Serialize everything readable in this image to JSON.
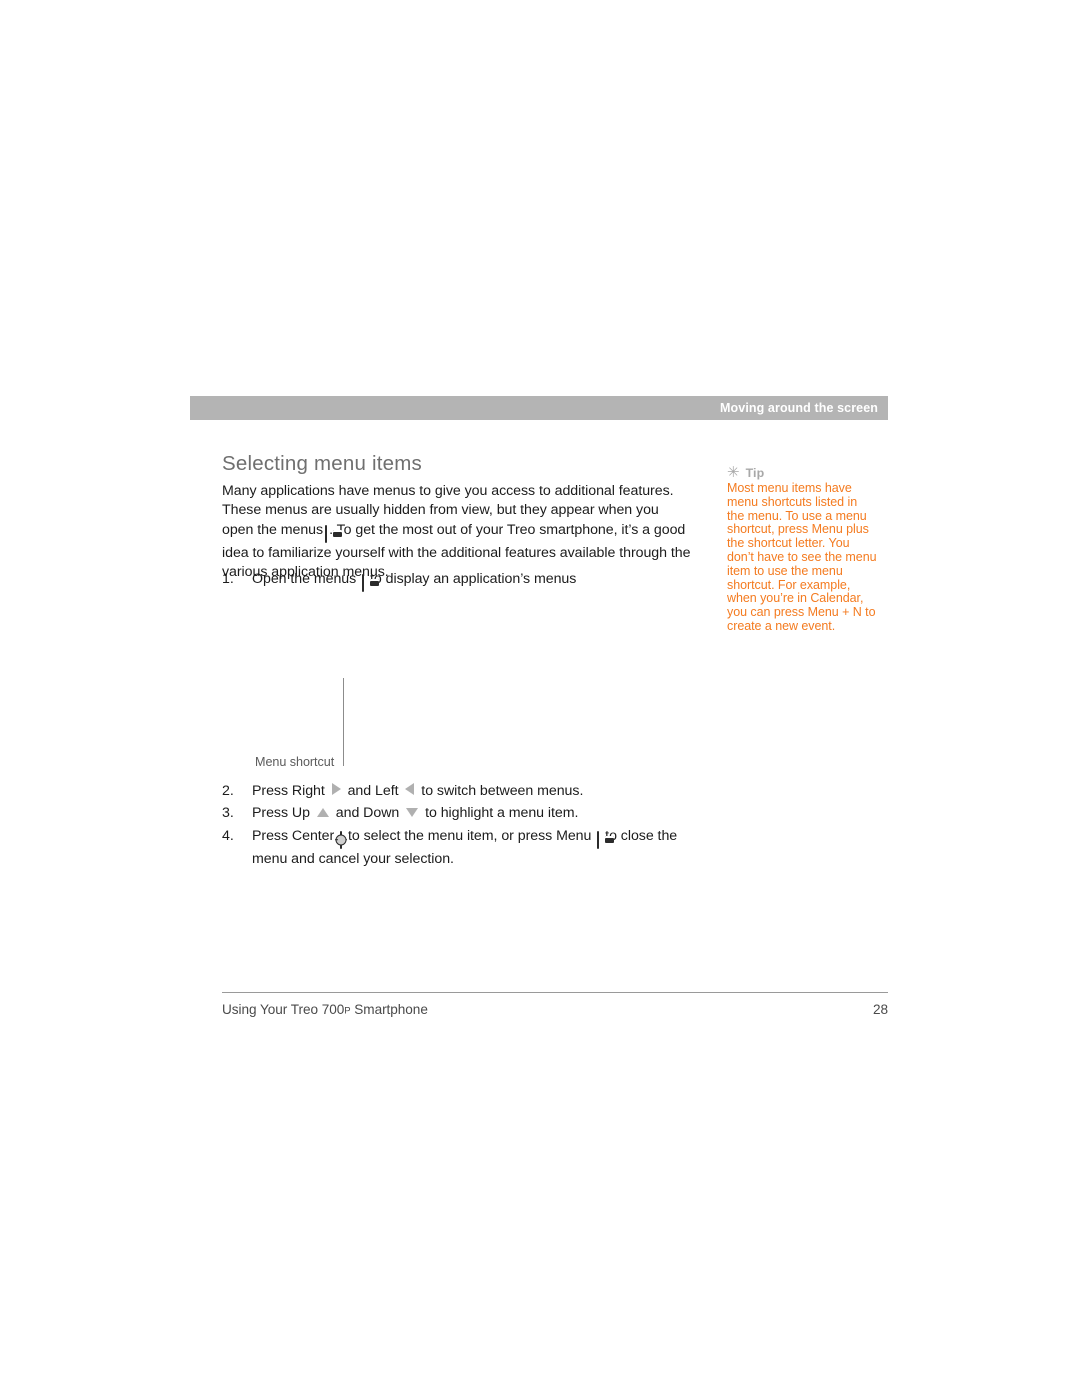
{
  "header": {
    "running_title": "Moving around the screen"
  },
  "main": {
    "section_title": "Selecting menu items",
    "paragraph_part1": "Many applications have menus to give you access to additional features. These menus are usually hidden from view, but they appear when you open the menus",
    "paragraph_part2": ". To get the most out of your Treo smartphone, it’s a good idea to familiarize yourself with the additional features available through the various application menus.",
    "steps": [
      {
        "number": "1.",
        "text_before": "Open the menus",
        "icon": "menu-key-icon",
        "text_after": "to display an application’s menus"
      },
      {
        "number": "2.",
        "text_before": "Press Right",
        "icon": "right-arrow-icon",
        "text_mid": "and Left",
        "icon2": "left-arrow-icon",
        "text_after": "to switch between menus."
      },
      {
        "number": "3.",
        "text_before": "Press Up",
        "icon": "up-arrow-icon",
        "text_mid": "and Down",
        "icon2": "down-arrow-icon",
        "text_after": "to highlight a menu item."
      },
      {
        "number": "4.",
        "text_before": "Press Center",
        "icon": "center-key-icon",
        "text_mid": "to select the menu item, or press Menu",
        "icon2": "menu-key-icon",
        "text_after": "to close the menu and cancel your selection."
      }
    ]
  },
  "callout": {
    "label": "Menu shortcut"
  },
  "tip": {
    "asterisk": "✳",
    "label": "Tip",
    "body": "Most menu items have menu shortcuts listed in the menu. To use a menu shortcut, press Menu plus the shortcut letter. You don’t have to see the menu item to use the menu shortcut. For example, when you’re in Calendar, you can press Menu + N to create a new event."
  },
  "footer": {
    "title_before": "Using Your Treo 700",
    "model_sup": "P",
    "title_after": " Smartphone",
    "page_number": "28"
  },
  "colors": {
    "header_bar": "#b4b4b4",
    "header_text": "#ffffff",
    "section_title": "#6f6f6f",
    "body_text": "#1c1c1c",
    "tip_accent": "#f47b20",
    "tip_label": "#a8a8a8",
    "arrow_gray": "#b0b0b0",
    "footer_text": "#4a4a4a"
  }
}
